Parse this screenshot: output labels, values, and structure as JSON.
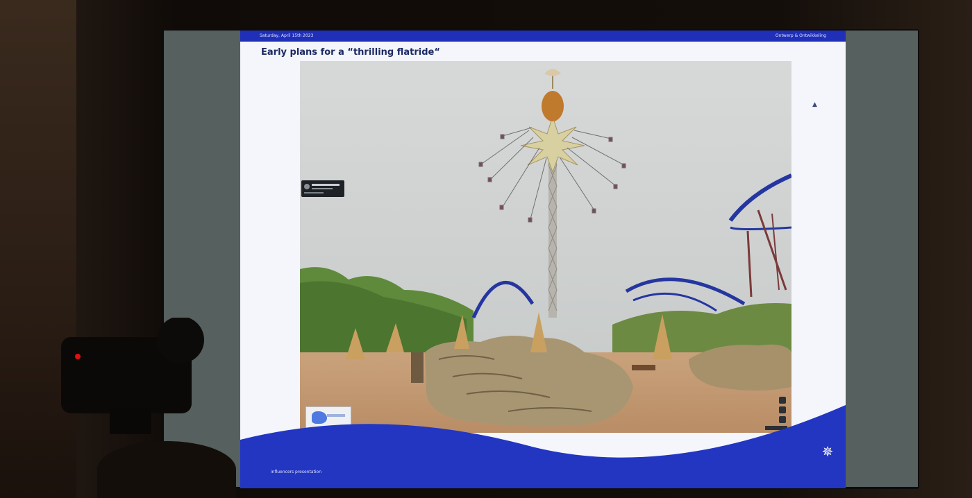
{
  "slide": {
    "date": "Saturday, April 15th 2023",
    "header_right": "Ontwerp & Ontwikkeling",
    "title": "Early plans for a “thrilling flatride“",
    "footer_text": "influencers presentation",
    "logo": "compass-star"
  },
  "photo": {
    "description_icon": "image",
    "embed_card": "street-view-card",
    "minimap": "map-thumbnail"
  },
  "colors": {
    "slide_blue": "#1f2fb8",
    "title_navy": "#1c2a63",
    "slide_bg": "#f4f6fb"
  }
}
